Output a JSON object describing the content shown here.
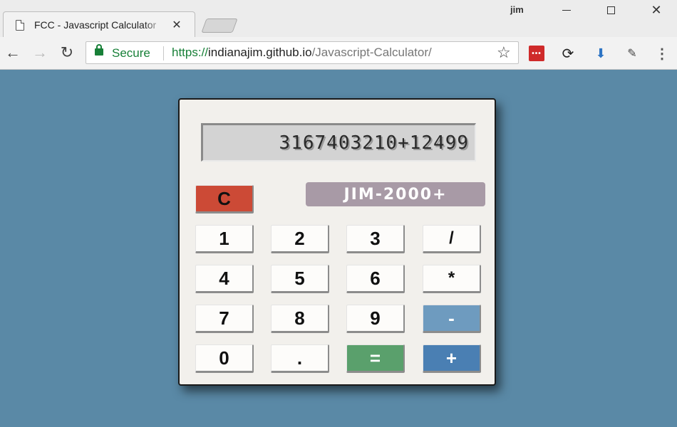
{
  "browser": {
    "tab_title": "FCC - Javascript Calculator",
    "tab_close": "✕",
    "user_name": "jim",
    "secure_label": "Secure",
    "url_scheme": "https://",
    "url_host": "indianajim.github.io",
    "url_path": "/Javascript-Calculator/",
    "icons": [
      "page-icon",
      "back-arrow-icon",
      "forward-arrow-icon",
      "reload-icon",
      "lock-icon",
      "star-icon",
      "lastpass-icon",
      "sync-icon",
      "download-icon",
      "evernote-icon",
      "menu-icon",
      "minimize-icon",
      "maximize-icon",
      "close-icon"
    ]
  },
  "calculator": {
    "display": "3167403210+12499",
    "brand": "JIM-2000+",
    "clear_label": "C",
    "keys": {
      "k1": "1",
      "k2": "2",
      "k3": "3",
      "div": "/",
      "k4": "4",
      "k5": "5",
      "k6": "6",
      "mul": "*",
      "k7": "7",
      "k8": "8",
      "k9": "9",
      "sub": "-",
      "k0": "0",
      "dot": ".",
      "eq": "=",
      "add": "+"
    },
    "colors": {
      "background": "#5a89a6",
      "clear": "#cc4a36",
      "minus": "#6e9bbf",
      "equals": "#5aa06c",
      "plus": "#4a7fb3",
      "brand_bg": "#a89aa6"
    }
  }
}
